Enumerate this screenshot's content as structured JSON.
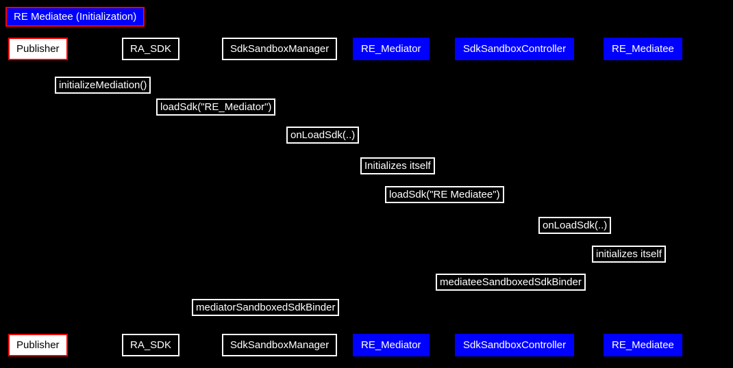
{
  "title": "RE Mediatee (Initialization)",
  "participants": {
    "publisher": "Publisher",
    "ra_sdk": "RA_SDK",
    "sandbox_manager": "SdkSandboxManager",
    "mediator": "RE_Mediator",
    "sandbox_controller": "SdkSandboxController",
    "mediatee": "RE_Mediatee"
  },
  "messages": {
    "init_mediation": "initializeMediation()",
    "load_mediator": "loadSdk(\"RE_Mediator\")",
    "onload_1": "onLoadSdk(..)",
    "init_self_1": "Initializes itself",
    "load_mediatee": "loadSdk(\"RE Mediatee\")",
    "onload_2": "onLoadSdk(..)",
    "init_self_2": "initializes itself",
    "mediatee_binder": "mediateeSandboxedSdkBinder",
    "mediator_binder": "mediatorSandboxedSdkBinder"
  }
}
